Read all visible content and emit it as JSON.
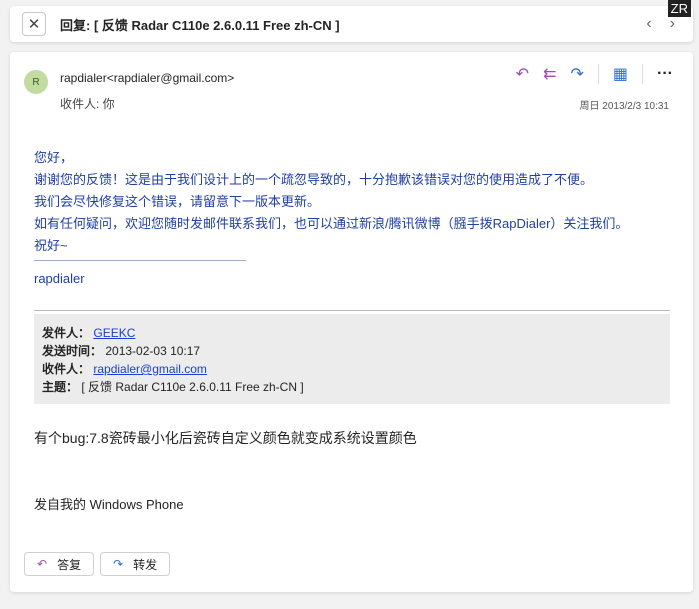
{
  "header": {
    "title": "回复: [ 反馈 Radar C110e 2.6.0.11 Free zh-CN ]",
    "close": "✕",
    "prev": "‹",
    "next": "›",
    "badge": "ZR"
  },
  "email": {
    "avatar": "R",
    "from": "rapdialer<rapdialer@gmail.com>",
    "to": "收件人: 你",
    "date": "周日 2013/2/3 10:31",
    "icons": {
      "reply": "↶",
      "reply_all": "⇇",
      "forward": "↷",
      "apps": "▦",
      "more": "···"
    },
    "body": [
      "您好，",
      "谢谢您的反馈！这是由于我们设计上的一个疏忽导致的，十分抱歉该错误对您的使用造成了不便。",
      "我们会尽快修复这个错误，请留意下一版本更新。",
      "如有任何疑问，欢迎您随时发邮件联系我们，也可以通过新浪/腾讯微博（膙手拨RapDialer）关注我们。",
      "祝好~"
    ],
    "signature": "rapdialer",
    "quote": {
      "from_label": "发件人：",
      "from": "GEEKC",
      "sent_label": "发送时间：",
      "sent": "2013-02-03 10:17",
      "to_label": "收件人：",
      "to": "rapdialer@gmail.com",
      "subject_label": "主题：",
      "subject": "[ 反馈 Radar C110e 2.6.0.11 Free zh-CN ]"
    },
    "message": "有个bug:7.8瓷砖最小化后瓷砖自定义颜色就变成系统设置颜色",
    "sent_from": "发自我的 Windows Phone"
  },
  "buttons": {
    "reply": "答复",
    "forward": "转发"
  }
}
